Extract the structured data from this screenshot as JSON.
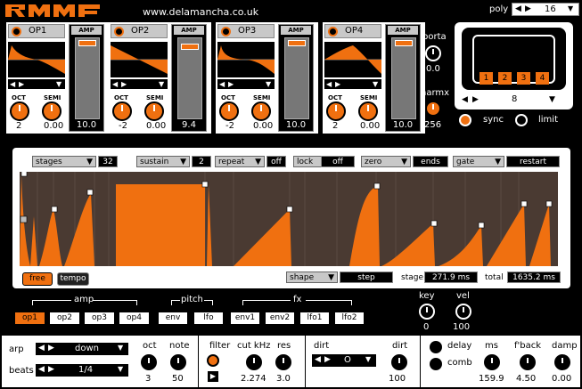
{
  "header": {
    "logo": "RMMF",
    "url": "www.delamancha.co.uk",
    "poly_label": "poly",
    "poly_value": "16"
  },
  "ops": [
    {
      "name": "OP1",
      "amp": "10.0",
      "oct": "2",
      "semi": "0.00",
      "thumb_frac": 0.0
    },
    {
      "name": "OP2",
      "amp": "9.4",
      "oct": "-2",
      "semi": "0.00",
      "thumb_frac": 0.05
    },
    {
      "name": "OP3",
      "amp": "10.0",
      "oct": "-2",
      "semi": "0.00",
      "thumb_frac": 0.0
    },
    {
      "name": "OP4",
      "amp": "10.0",
      "oct": "2",
      "semi": "0.00",
      "thumb_frac": 0.0
    }
  ],
  "labels": {
    "amp": "AMP",
    "oct": "OCT",
    "semi": "SEMI"
  },
  "porta": {
    "label": "porta",
    "value": "0.0"
  },
  "harmx": {
    "label": "harmx",
    "value": "256"
  },
  "display": {
    "buttons": [
      "1",
      "2",
      "3",
      "4"
    ],
    "value": "8"
  },
  "sync_label": "sync",
  "limit_label": "limit",
  "env": {
    "stages_label": "stages",
    "stages_value": "32",
    "sustain_label": "sustain",
    "sustain_value": "2",
    "repeat_label": "repeat",
    "repeat_value": "off",
    "lock_label": "lock",
    "lock_value": "off",
    "zero_label": "zero",
    "zero_value": "ends",
    "gate_label": "gate",
    "gate_value": "restart",
    "free": "free",
    "tempo": "tempo",
    "shape_label": "shape",
    "shape_value": "step",
    "stage_label": "stage",
    "stage_value": "271.9 ms",
    "total_label": "total",
    "total_value": "1635.2 ms"
  },
  "routing": {
    "amp_label": "amp",
    "pitch_label": "pitch",
    "fx_label": "fx",
    "amp_buttons": [
      "op1",
      "op2",
      "op3",
      "op4"
    ],
    "pitch_buttons": [
      "env",
      "lfo"
    ],
    "fx_buttons": [
      "env1",
      "env2",
      "lfo1",
      "lfo2"
    ]
  },
  "key": {
    "label": "key",
    "value": "0"
  },
  "vel": {
    "label": "vel",
    "value": "100"
  },
  "bottom": {
    "arp_label": "arp",
    "arp_value": "down",
    "beats_label": "beats",
    "beats_value": "1/4",
    "oct_label": "oct",
    "oct_value": "3",
    "note_label": "note",
    "note_value": "50",
    "filter_label": "filter",
    "cutkhz_label": "cut kHz",
    "cutkhz_value": "2.274",
    "res_label": "res",
    "res_value": "3.0",
    "dirt_label": "dirt",
    "dirt_select": "O",
    "dirt_value": "100",
    "delay_label": "delay",
    "comb_label": "comb",
    "ms_label": "ms",
    "ms_value": "159.9",
    "fback_label": "f'back",
    "fback_value": "4.50",
    "damp_label": "damp",
    "damp_value": "0.00"
  }
}
